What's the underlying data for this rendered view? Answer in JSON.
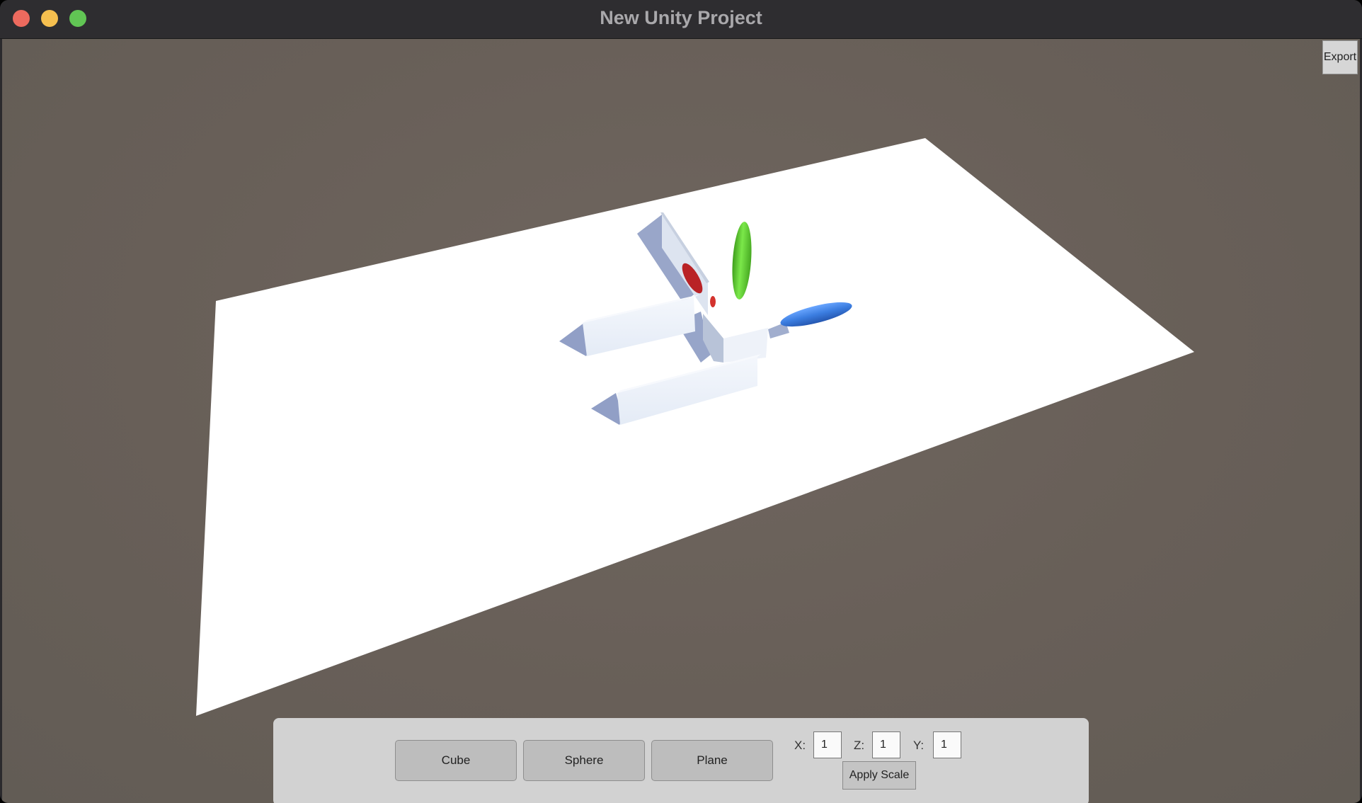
{
  "window": {
    "title": "New Unity Project"
  },
  "viewport": {
    "export_label": "Export",
    "objects": [
      {
        "name": "ground-plane",
        "color": "#ffffff"
      },
      {
        "name": "green-capsule",
        "color": "#5ccf2e"
      },
      {
        "name": "blue-capsule",
        "color": "#3b7de0"
      },
      {
        "name": "red-capsule",
        "color": "#c0282a"
      }
    ]
  },
  "toolbar": {
    "cube_label": "Cube",
    "sphere_label": "Sphere",
    "plane_label": "Plane",
    "x_label": "X:",
    "z_label": "Z:",
    "y_label": "Y:",
    "x_value": "1",
    "z_value": "1",
    "y_value": "1",
    "apply_label": "Apply Scale"
  },
  "colors": {
    "background": "#685f58",
    "toolbar": "#d2d2d2"
  }
}
